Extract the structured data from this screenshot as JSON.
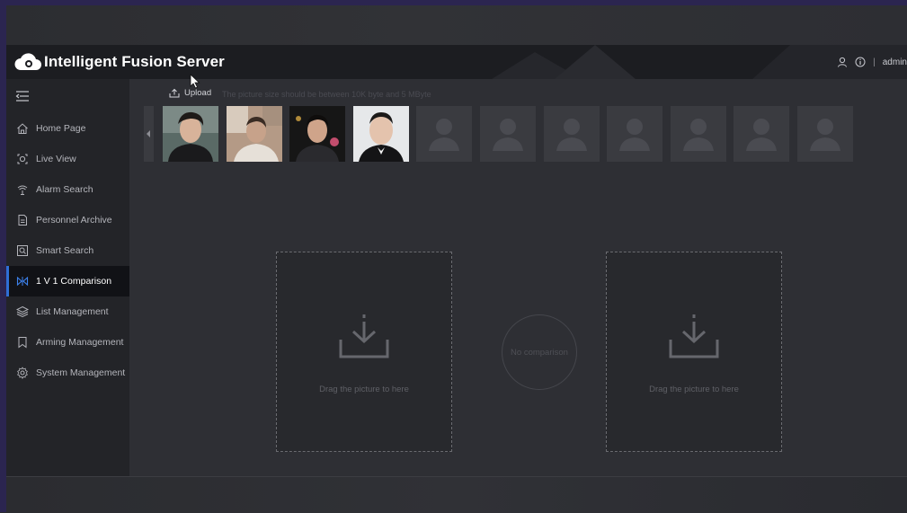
{
  "header": {
    "app_title": "Intelligent Fusion Server",
    "username": "admin",
    "separator": "|",
    "icons": [
      "cloud-logo-icon",
      "user-icon",
      "info-icon"
    ]
  },
  "sidebar": {
    "collapse_icon": "menu-collapse-icon",
    "items": [
      {
        "label": "Home Page",
        "icon": "home-icon"
      },
      {
        "label": "Live View",
        "icon": "live-view-icon"
      },
      {
        "label": "Alarm Search",
        "icon": "alarm-icon"
      },
      {
        "label": "Personnel Archive",
        "icon": "document-icon"
      },
      {
        "label": "Smart Search",
        "icon": "smart-search-icon"
      },
      {
        "label": "1 V 1 Comparison",
        "icon": "comparison-icon",
        "active": true
      },
      {
        "label": "List Management",
        "icon": "layers-icon"
      },
      {
        "label": "Arming Management",
        "icon": "bookmark-icon"
      },
      {
        "label": "System Management",
        "icon": "gear-icon"
      }
    ]
  },
  "main": {
    "upload_label": "Upload",
    "upload_hint": "The picture size should be between 10K byte and 5 MByte",
    "thumbnails": [
      "photo",
      "photo",
      "photo",
      "photo",
      "empty",
      "empty",
      "empty",
      "empty",
      "empty",
      "empty",
      "empty"
    ],
    "left_drop_text": "Drag the picture to here",
    "right_drop_text": "Drag the picture to here",
    "compare_text": "No comparison"
  },
  "colors": {
    "accent": "#2f6fd6",
    "header_bg": "#1c1d21",
    "sidebar_bg": "#232428",
    "content_bg": "#2e2f34"
  }
}
